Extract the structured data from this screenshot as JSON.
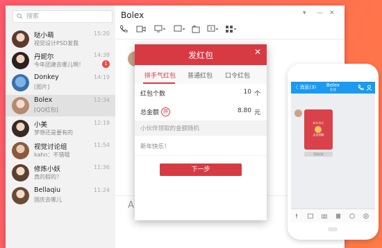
{
  "sidebar": {
    "search_placeholder": "搜索",
    "items": [
      {
        "name": "哒小萌",
        "preview": "视觉设计PSD发我",
        "time": "15:20",
        "badge": ""
      },
      {
        "name": "丹妮尔",
        "preview": "今年团建去哪儿啊！",
        "time": "14:38",
        "badge": "1"
      },
      {
        "name": "Donkey",
        "preview": "[图片]",
        "time": "14:19",
        "badge": ""
      },
      {
        "name": "Bolex",
        "preview": "[QQ红包]",
        "time": "12:34",
        "badge": ""
      },
      {
        "name": "小美",
        "preview": "梦想还是要有的",
        "time": "12:19",
        "badge": ""
      },
      {
        "name": "视觉讨论组",
        "preview": "kahn：不错哦",
        "time": "11:54",
        "badge": ""
      },
      {
        "name": "修炼小妖",
        "preview": "真的假的？",
        "time": "11:36",
        "badge": ""
      },
      {
        "name": "Bellaqiu",
        "preview": "国庆去哪儿",
        "time": "11:24",
        "badge": ""
      }
    ]
  },
  "chat": {
    "title": "Bolex",
    "input_glyph": "A"
  },
  "dialog": {
    "title": "发红包",
    "tabs": [
      "拼手气红包",
      "普通红包",
      "口令红包"
    ],
    "count_label": "红包个数",
    "count_value": "10",
    "count_unit": "个",
    "amount_label": "总金额",
    "pin_glyph": "拼",
    "amount_value": "8.80",
    "amount_unit": "元",
    "hint": "小伙伴领取的金额随机",
    "greeting": "新年快乐！",
    "next_button": "下一步"
  },
  "phone": {
    "back": "〈 消息(3)",
    "title": "Bolex",
    "subtitle": "在线",
    "packet_title": "新年快乐",
    "packet_action": "点击领取",
    "packet_caption": "QQ红包"
  },
  "colors": {
    "accent": "#d83a44",
    "phone_bar": "#1a9af0",
    "badge": "#f04848"
  }
}
